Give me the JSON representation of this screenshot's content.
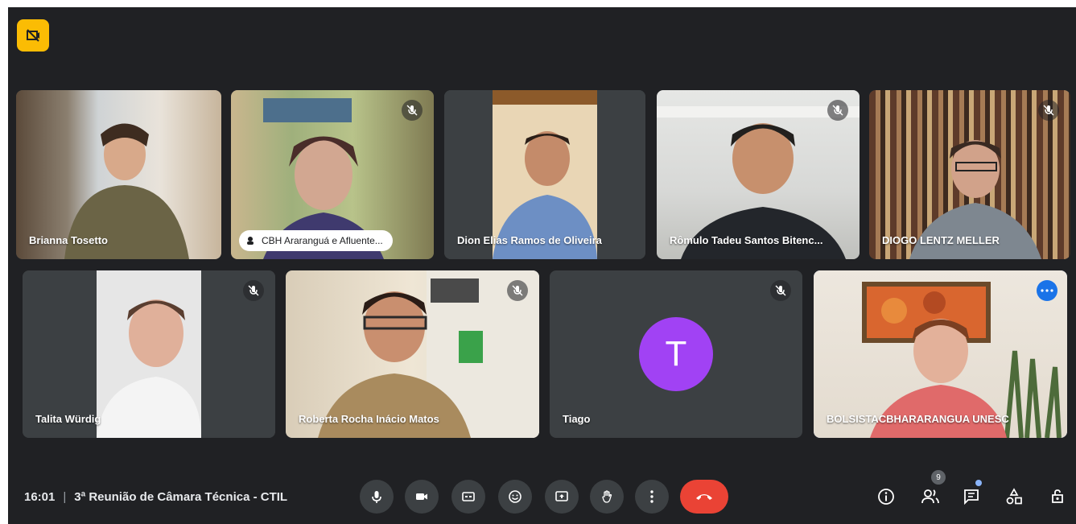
{
  "meeting": {
    "time": "16:01",
    "title": "3ª Reunião de Câmara Técnica - CTIL"
  },
  "participant_count": "9",
  "participants": [
    {
      "name": "Brianna Tosetto",
      "muted": false
    },
    {
      "name": "CBH Araranguá e Afluente...",
      "muted": true,
      "presenting_pill": true
    },
    {
      "name": "Dion Elias Ramos de Oliveira",
      "muted": false
    },
    {
      "name": "Rômulo Tadeu Santos Bitenc...",
      "muted": true
    },
    {
      "name": "DIOGO LENTZ MELLER",
      "muted": true
    },
    {
      "name": "Talita Würdig",
      "muted": true
    },
    {
      "name": "Roberta Rocha Inácio Matos",
      "muted": true
    },
    {
      "name": "Tiago",
      "muted": true,
      "avatar_letter": "T",
      "avatar_color": "#a142f4"
    },
    {
      "name": "BOLSISTACBHARARANGUA UNESC",
      "muted": false,
      "active": true
    }
  ],
  "controls": {
    "mic": "microphone-icon",
    "camera": "camera-icon",
    "captions": "captions-icon",
    "reactions": "emoji-icon",
    "present": "present-screen-icon",
    "raise_hand": "raise-hand-icon",
    "more": "more-options-icon",
    "hangup": "hang-up-icon"
  },
  "side_controls": [
    "info-icon",
    "people-icon",
    "chat-icon",
    "activities-icon",
    "host-controls-icon"
  ],
  "colors": {
    "background": "#202124",
    "tile": "#3c4043",
    "hangup": "#ea4335",
    "active_border": "#8ab4f8",
    "badge": "#fbbc04"
  }
}
